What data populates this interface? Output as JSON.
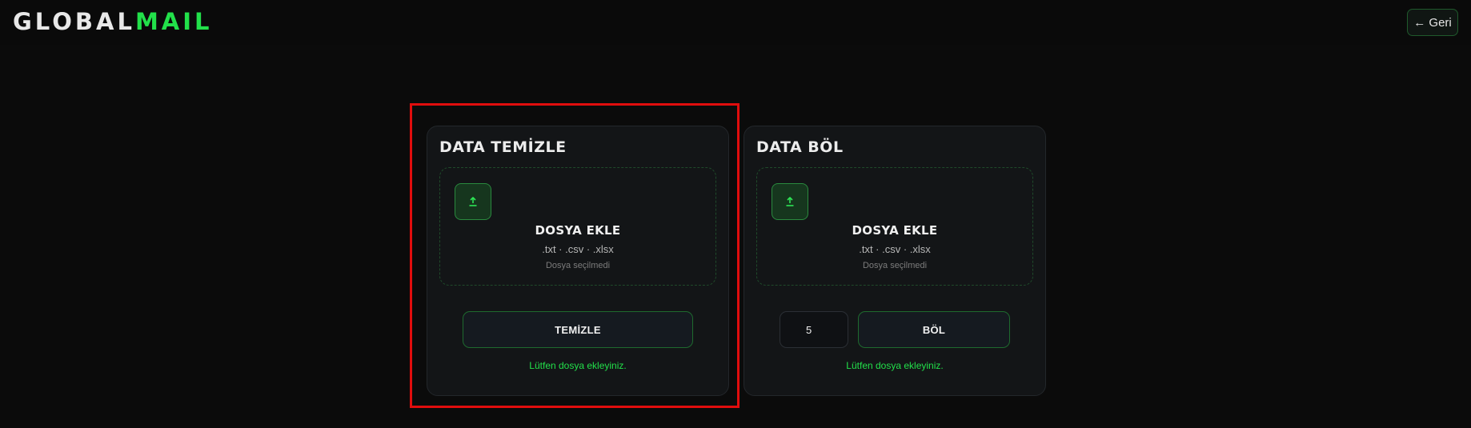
{
  "header": {
    "logo_part1": "GLOBAL",
    "logo_part2": "MAIL",
    "back_label": "← Geri"
  },
  "clean_card": {
    "title": "DATA TEMİZLE",
    "dropzone": {
      "icon": "upload-icon",
      "title": "DOSYA EKLE",
      "formats": ".txt · .csv · .xlsx",
      "status": "Dosya seçilmedi"
    },
    "button_label": "TEMİZLE",
    "note": "Lütfen dosya ekleyiniz."
  },
  "split_card": {
    "title": "DATA BÖL",
    "dropzone": {
      "icon": "upload-icon",
      "title": "DOSYA EKLE",
      "formats": ".txt · .csv · .xlsx",
      "status": "Dosya seçilmedi"
    },
    "count_value": "5",
    "button_label": "BÖL",
    "note": "Lütfen dosya ekleyiniz."
  },
  "colors": {
    "accent": "#22e04a",
    "background": "#0b0b0b",
    "card": "#131517",
    "highlight": "#e00d0d"
  }
}
